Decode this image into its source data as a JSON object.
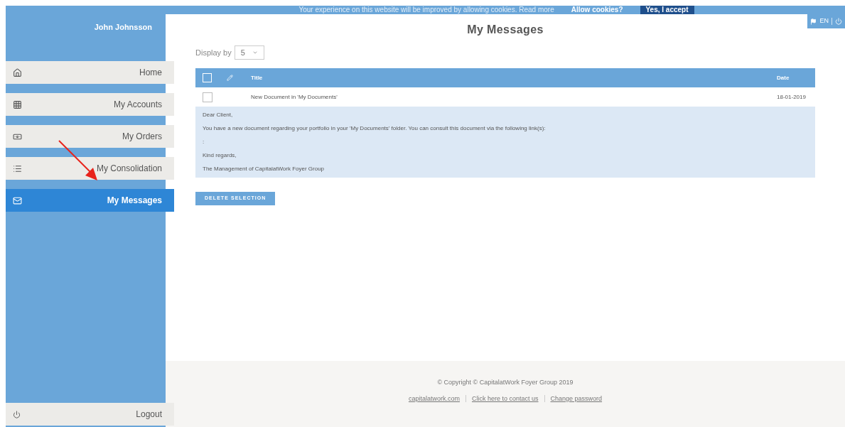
{
  "cookie_banner": {
    "message": "Your experience on this website will be improved by allowing cookies. Read more",
    "question": "Allow cookies?",
    "accept": "Yes, I accept"
  },
  "sidebar": {
    "user_name": "John Johnsson",
    "items": [
      {
        "label": "Home",
        "selected": false
      },
      {
        "label": "My Accounts",
        "selected": false
      },
      {
        "label": "My Orders",
        "selected": false
      },
      {
        "label": "My Consolidation",
        "selected": false
      },
      {
        "label": "My Messages",
        "selected": true
      }
    ],
    "logout": "Logout"
  },
  "top_right": {
    "language": "EN"
  },
  "page_title": "My Messages",
  "display_by": {
    "label": "Display by",
    "value": "5"
  },
  "table": {
    "all_checked": false,
    "columns": [
      "Title",
      "Date"
    ],
    "rows": [
      {
        "checked": false,
        "title": "New Document in 'My Documents'",
        "date": "18-01-2019",
        "expanded": true,
        "body": [
          "Dear Client,",
          "You have a new document regarding your portfolio in your 'My Documents' folder. You can consult this document via the following link(s):",
          ":",
          "Kind regards,",
          "The Management of CapitalatWork Foyer Group"
        ]
      }
    ]
  },
  "delete_button": "DELETE SELECTION",
  "footer": {
    "copyright": "© Copyright © CapitalatWork Foyer Group 2019",
    "links": [
      "capitalatwork.com",
      "Click here to contact us",
      "Change password"
    ]
  }
}
